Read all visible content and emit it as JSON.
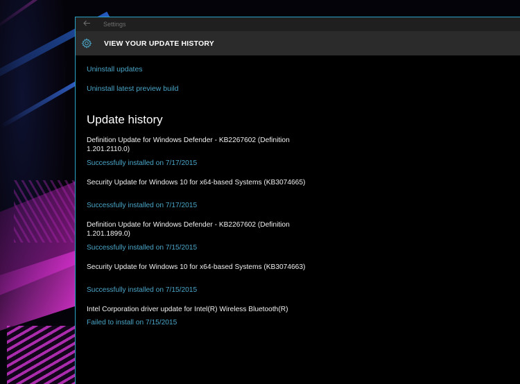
{
  "window": {
    "app_title": "Settings",
    "back_icon": "back-arrow-icon"
  },
  "header": {
    "icon": "gear-icon",
    "title": "VIEW YOUR UPDATE HISTORY"
  },
  "links": {
    "uninstall_updates": "Uninstall updates",
    "uninstall_preview": "Uninstall latest preview build"
  },
  "history": {
    "title": "Update history",
    "entries": [
      {
        "name": "Definition Update for Windows Defender - KB2267602 (Definition 1.201.2110.0)",
        "status": "Successfully installed on 7/17/2015"
      },
      {
        "name": "Security Update for Windows 10 for x64-based Systems (KB3074665)",
        "status": "Successfully installed on 7/17/2015"
      },
      {
        "name": "Definition Update for Windows Defender - KB2267602 (Definition 1.201.1899.0)",
        "status": "Successfully installed on 7/15/2015"
      },
      {
        "name": "Security Update for Windows 10 for x64-based Systems (KB3074663)",
        "status": "Successfully installed on 7/15/2015"
      },
      {
        "name": "Intel Corporation driver update for Intel(R) Wireless Bluetooth(R)",
        "status": "Failed to install on 7/15/2015"
      }
    ]
  },
  "colors": {
    "accent": "#4aa6c8",
    "header_bg": "#2b2b2b",
    "titlebar_bg": "#1f1f1f",
    "window_bg": "#000000"
  }
}
